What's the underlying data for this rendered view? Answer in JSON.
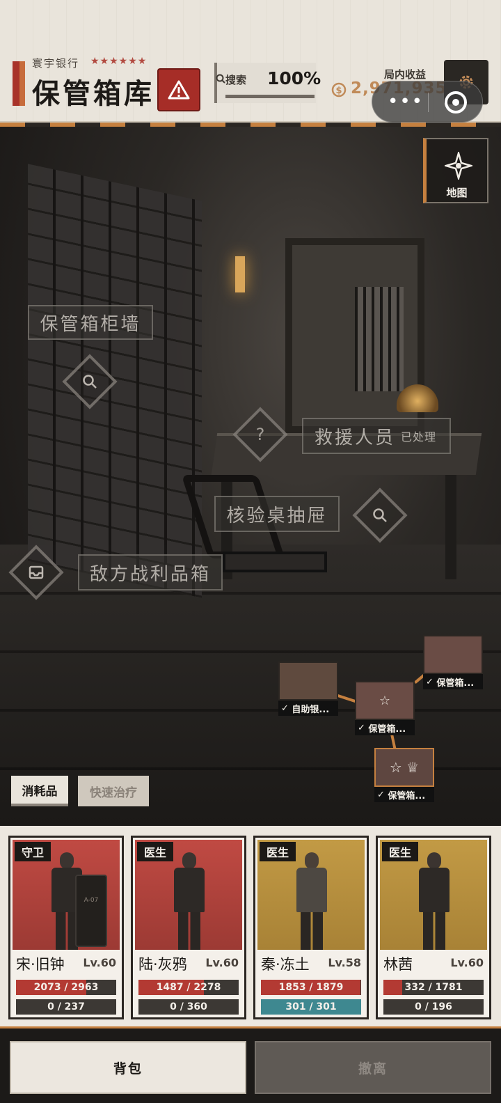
{
  "header": {
    "bank_name": "寰宇银行",
    "stars": "★★★★★★",
    "title": "保管箱库",
    "search_label": "搜索",
    "search_value": "100%",
    "income_label": "局内收益",
    "income_value": "2,971,935"
  },
  "scene": {
    "hotspots": {
      "wall_label": "保管箱柜墙",
      "rescue_label": "救援人员",
      "rescue_status": "已处理",
      "drawer_label": "核验桌抽屉",
      "loot_label": "敌方战利品箱",
      "rescue_icon": "?"
    },
    "map_label": "地图"
  },
  "minimap": {
    "nodes": [
      {
        "label": "自助银...",
        "color": "#5f4a3e"
      },
      {
        "label": "保管箱...",
        "color": "#6a4c45"
      },
      {
        "label": "保管箱...",
        "color": "#6a4c45"
      },
      {
        "label": "保管箱...",
        "color": "#5e4640"
      }
    ]
  },
  "tabs": {
    "consumables": "消耗品",
    "quick_heal": "快速治疗"
  },
  "party": [
    {
      "role": "守卫",
      "name": "宋·旧钟",
      "level": "Lv.60",
      "hp": "2073 / 2963",
      "hp_ratio": 0.7,
      "mp": "0 / 237",
      "mp_ratio": 0,
      "bg": "#b6463f",
      "shield_text": "A-07"
    },
    {
      "role": "医生",
      "name": "陆·灰鸦",
      "level": "Lv.60",
      "hp": "1487 / 2278",
      "hp_ratio": 0.65,
      "mp": "0 / 360",
      "mp_ratio": 0,
      "bg": "#b6463f"
    },
    {
      "role": "医生",
      "name": "秦·冻土",
      "level": "Lv.58",
      "hp": "1853 / 1879",
      "hp_ratio": 0.99,
      "mp": "301 / 301",
      "mp_ratio": 1,
      "bg": "#b8913f"
    },
    {
      "role": "医生",
      "name": "林茜",
      "level": "Lv.60",
      "hp": "332 / 1781",
      "hp_ratio": 0.19,
      "mp": "0 / 196",
      "mp_ratio": 0,
      "bg": "#b8913f"
    }
  ],
  "footer": {
    "backpack": "背包",
    "evacuate": "撤离"
  },
  "colors": {
    "accent": "#c5803f",
    "danger": "#a62d27",
    "hp": "#b33a33",
    "mp": "#3e8890"
  }
}
